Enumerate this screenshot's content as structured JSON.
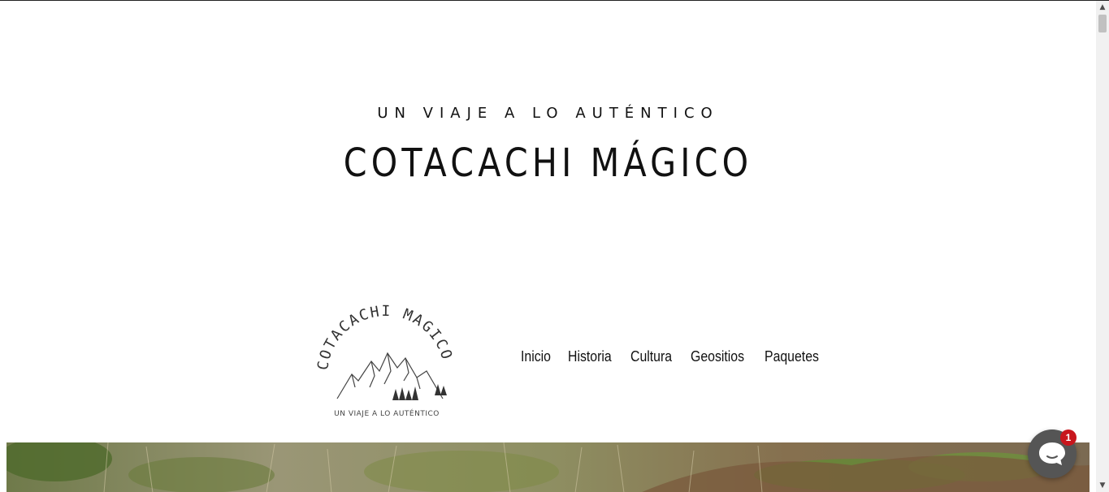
{
  "header": {
    "tagline": "UN VIAJE A LO AUTÉNTICO",
    "title": "COTACACHI MÁGICO"
  },
  "logo": {
    "arc_text": "COTACACHI MAGICO",
    "sub_text": "UN VIAJE A LO AUTÉNTICO"
  },
  "nav": {
    "items": [
      {
        "label": "Inicio"
      },
      {
        "label": "Historia"
      },
      {
        "label": "Cultura"
      },
      {
        "label": "Geositios"
      },
      {
        "label": "Paquetes"
      }
    ]
  },
  "chat": {
    "icon": "chat-bubble-icon",
    "badge_count": "1",
    "button_color": "#555555",
    "badge_color": "#c8161d"
  },
  "colors": {
    "text": "#111111",
    "background": "#ffffff"
  }
}
